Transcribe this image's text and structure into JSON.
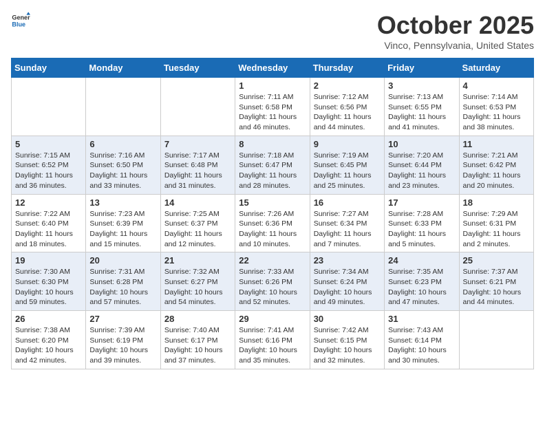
{
  "header": {
    "logo_general": "General",
    "logo_blue": "Blue",
    "month": "October 2025",
    "location": "Vinco, Pennsylvania, United States"
  },
  "weekdays": [
    "Sunday",
    "Monday",
    "Tuesday",
    "Wednesday",
    "Thursday",
    "Friday",
    "Saturday"
  ],
  "weeks": [
    [
      {
        "day": "",
        "info": ""
      },
      {
        "day": "",
        "info": ""
      },
      {
        "day": "",
        "info": ""
      },
      {
        "day": "1",
        "info": "Sunrise: 7:11 AM\nSunset: 6:58 PM\nDaylight: 11 hours and 46 minutes."
      },
      {
        "day": "2",
        "info": "Sunrise: 7:12 AM\nSunset: 6:56 PM\nDaylight: 11 hours and 44 minutes."
      },
      {
        "day": "3",
        "info": "Sunrise: 7:13 AM\nSunset: 6:55 PM\nDaylight: 11 hours and 41 minutes."
      },
      {
        "day": "4",
        "info": "Sunrise: 7:14 AM\nSunset: 6:53 PM\nDaylight: 11 hours and 38 minutes."
      }
    ],
    [
      {
        "day": "5",
        "info": "Sunrise: 7:15 AM\nSunset: 6:52 PM\nDaylight: 11 hours and 36 minutes."
      },
      {
        "day": "6",
        "info": "Sunrise: 7:16 AM\nSunset: 6:50 PM\nDaylight: 11 hours and 33 minutes."
      },
      {
        "day": "7",
        "info": "Sunrise: 7:17 AM\nSunset: 6:48 PM\nDaylight: 11 hours and 31 minutes."
      },
      {
        "day": "8",
        "info": "Sunrise: 7:18 AM\nSunset: 6:47 PM\nDaylight: 11 hours and 28 minutes."
      },
      {
        "day": "9",
        "info": "Sunrise: 7:19 AM\nSunset: 6:45 PM\nDaylight: 11 hours and 25 minutes."
      },
      {
        "day": "10",
        "info": "Sunrise: 7:20 AM\nSunset: 6:44 PM\nDaylight: 11 hours and 23 minutes."
      },
      {
        "day": "11",
        "info": "Sunrise: 7:21 AM\nSunset: 6:42 PM\nDaylight: 11 hours and 20 minutes."
      }
    ],
    [
      {
        "day": "12",
        "info": "Sunrise: 7:22 AM\nSunset: 6:40 PM\nDaylight: 11 hours and 18 minutes."
      },
      {
        "day": "13",
        "info": "Sunrise: 7:23 AM\nSunset: 6:39 PM\nDaylight: 11 hours and 15 minutes."
      },
      {
        "day": "14",
        "info": "Sunrise: 7:25 AM\nSunset: 6:37 PM\nDaylight: 11 hours and 12 minutes."
      },
      {
        "day": "15",
        "info": "Sunrise: 7:26 AM\nSunset: 6:36 PM\nDaylight: 11 hours and 10 minutes."
      },
      {
        "day": "16",
        "info": "Sunrise: 7:27 AM\nSunset: 6:34 PM\nDaylight: 11 hours and 7 minutes."
      },
      {
        "day": "17",
        "info": "Sunrise: 7:28 AM\nSunset: 6:33 PM\nDaylight: 11 hours and 5 minutes."
      },
      {
        "day": "18",
        "info": "Sunrise: 7:29 AM\nSunset: 6:31 PM\nDaylight: 11 hours and 2 minutes."
      }
    ],
    [
      {
        "day": "19",
        "info": "Sunrise: 7:30 AM\nSunset: 6:30 PM\nDaylight: 10 hours and 59 minutes."
      },
      {
        "day": "20",
        "info": "Sunrise: 7:31 AM\nSunset: 6:28 PM\nDaylight: 10 hours and 57 minutes."
      },
      {
        "day": "21",
        "info": "Sunrise: 7:32 AM\nSunset: 6:27 PM\nDaylight: 10 hours and 54 minutes."
      },
      {
        "day": "22",
        "info": "Sunrise: 7:33 AM\nSunset: 6:26 PM\nDaylight: 10 hours and 52 minutes."
      },
      {
        "day": "23",
        "info": "Sunrise: 7:34 AM\nSunset: 6:24 PM\nDaylight: 10 hours and 49 minutes."
      },
      {
        "day": "24",
        "info": "Sunrise: 7:35 AM\nSunset: 6:23 PM\nDaylight: 10 hours and 47 minutes."
      },
      {
        "day": "25",
        "info": "Sunrise: 7:37 AM\nSunset: 6:21 PM\nDaylight: 10 hours and 44 minutes."
      }
    ],
    [
      {
        "day": "26",
        "info": "Sunrise: 7:38 AM\nSunset: 6:20 PM\nDaylight: 10 hours and 42 minutes."
      },
      {
        "day": "27",
        "info": "Sunrise: 7:39 AM\nSunset: 6:19 PM\nDaylight: 10 hours and 39 minutes."
      },
      {
        "day": "28",
        "info": "Sunrise: 7:40 AM\nSunset: 6:17 PM\nDaylight: 10 hours and 37 minutes."
      },
      {
        "day": "29",
        "info": "Sunrise: 7:41 AM\nSunset: 6:16 PM\nDaylight: 10 hours and 35 minutes."
      },
      {
        "day": "30",
        "info": "Sunrise: 7:42 AM\nSunset: 6:15 PM\nDaylight: 10 hours and 32 minutes."
      },
      {
        "day": "31",
        "info": "Sunrise: 7:43 AM\nSunset: 6:14 PM\nDaylight: 10 hours and 30 minutes."
      },
      {
        "day": "",
        "info": ""
      }
    ]
  ]
}
